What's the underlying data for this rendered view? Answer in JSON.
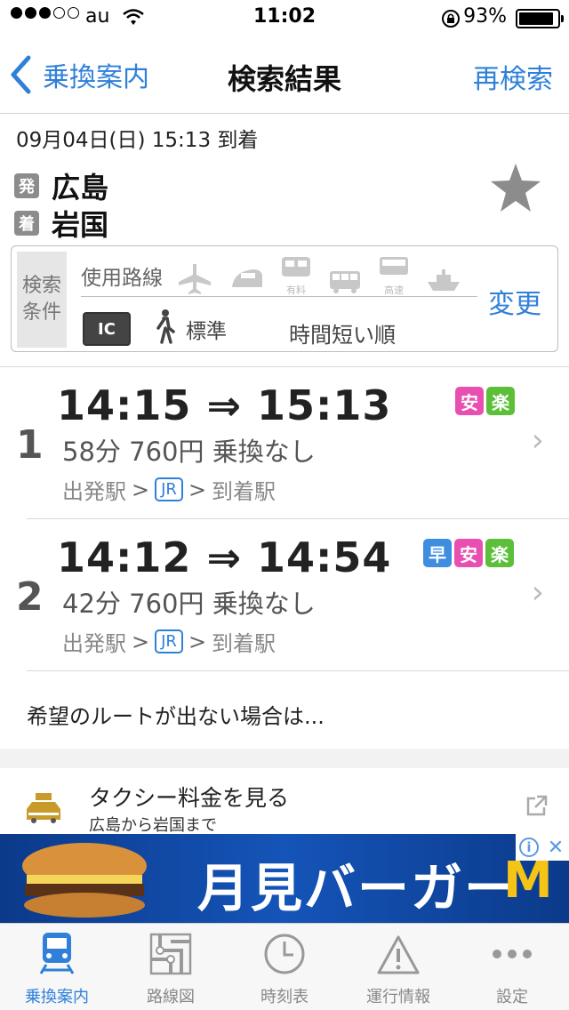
{
  "status": {
    "carrier": "au",
    "time": "11:02",
    "battery": "93%",
    "signal_filled": 3,
    "signal_total": 5
  },
  "nav": {
    "back_label": "乗換案内",
    "title": "検索結果",
    "research_label": "再検索"
  },
  "search": {
    "datetime": "09月04日(日) 15:13 到着",
    "from_badge": "発",
    "from": "広島",
    "to_badge": "着",
    "to": "岩国",
    "favorite_icon": "star-icon"
  },
  "conditions": {
    "label": "検索\n条件",
    "lines_label": "使用路線",
    "transport_icons": [
      {
        "name": "airplane-icon",
        "caption": ""
      },
      {
        "name": "shinkansen-icon",
        "caption": ""
      },
      {
        "name": "limited-express-icon",
        "caption": "有料"
      },
      {
        "name": "bus-icon",
        "caption": ""
      },
      {
        "name": "highway-bus-icon",
        "caption": "高速"
      },
      {
        "name": "ferry-icon",
        "caption": ""
      }
    ],
    "ic_label": "IC",
    "walk_label": "標準",
    "sort_label": "時間短い順",
    "change_label": "変更"
  },
  "routes": [
    {
      "index": "1",
      "depart": "14:15",
      "arrow": "⇒",
      "arrive": "15:13",
      "meta": "58分  760円  乗換なし",
      "from_label": "出発駅",
      "line": "JR",
      "to_label": "到着駅",
      "tags": [
        {
          "label": "安",
          "color": "#e84fb0"
        },
        {
          "label": "楽",
          "color": "#5bbf3a"
        }
      ]
    },
    {
      "index": "2",
      "depart": "14:12",
      "arrow": "⇒",
      "arrive": "14:54",
      "meta": "42分  760円  乗換なし",
      "from_label": "出発駅",
      "line": "JR",
      "to_label": "到着駅",
      "tags": [
        {
          "label": "早",
          "color": "#3e8de0"
        },
        {
          "label": "安",
          "color": "#e84fb0"
        },
        {
          "label": "楽",
          "color": "#5bbf3a"
        }
      ]
    }
  ],
  "hint": "希望のルートが出ない場合は...",
  "taxi": {
    "title": "タクシー料金を見る",
    "subtitle": "広島から岩国まで",
    "icon_label": "TAXI"
  },
  "ad": {
    "text": "月見バーガー",
    "brand": "M"
  },
  "tabs": [
    {
      "label": "乗換案内",
      "icon": "train-icon",
      "active": true
    },
    {
      "label": "路線図",
      "icon": "route-map-icon",
      "active": false
    },
    {
      "label": "時刻表",
      "icon": "clock-icon",
      "active": false
    },
    {
      "label": "運行情報",
      "icon": "warning-icon",
      "active": false
    },
    {
      "label": "設定",
      "icon": "more-icon",
      "active": false
    }
  ],
  "colors": {
    "accent": "#2f80d9",
    "safe": "#e84fb0",
    "easy": "#5bbf3a",
    "fast": "#3e8de0"
  }
}
